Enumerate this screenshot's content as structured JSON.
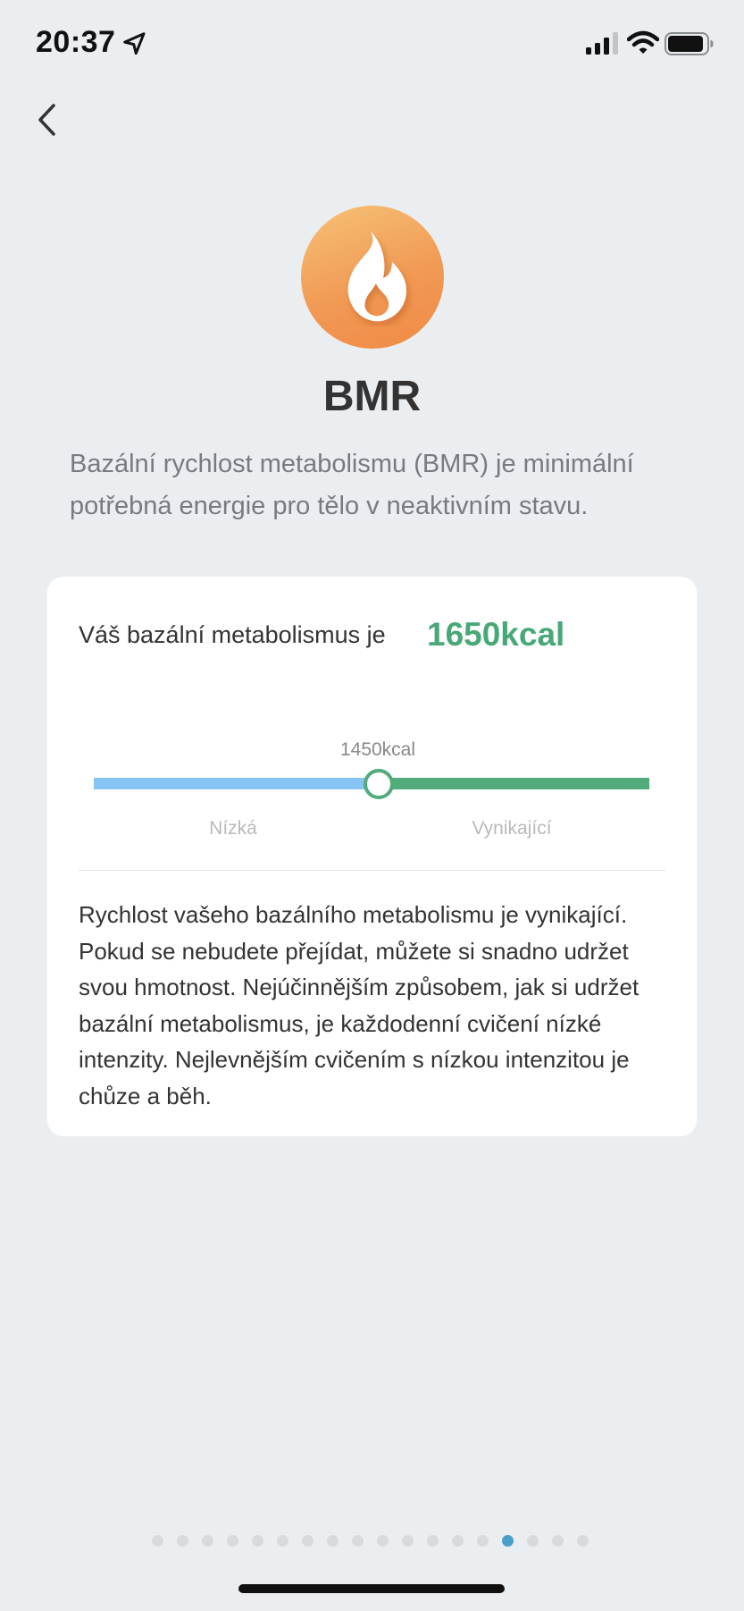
{
  "status_bar": {
    "time": "20:37"
  },
  "header": {
    "back_icon": "chevron-left-icon"
  },
  "hero": {
    "icon": "flame-icon",
    "icon_gradient": [
      "#f6c275",
      "#ef8a45"
    ],
    "title": "BMR",
    "description": "Bazální rychlost metabolismu (BMR) je minimální potřebná energie pro tělo v neaktivním stavu."
  },
  "card": {
    "label": "Váš bazální metabolismus je",
    "value": "1650kcal",
    "value_color": "#48a877",
    "slider": {
      "threshold_label": "1450kcal",
      "low_label": "Nízká",
      "high_label": "Vynikající",
      "low_color": "#86c4f3",
      "high_color": "#52ab7a"
    },
    "body": "Rychlost vašeho bazálního metabolismu je vynikající. Pokud se nebudete přejídat, můžete si snadno udržet svou hmotnost. Nejúčinnějším způsobem, jak si udržet bazální metabolismus, je každodenní cvičení nízké intenzity. Nejlevnějším cvičením s nízkou intenzitou je chůze a běh."
  },
  "pagination": {
    "total": 18,
    "active_index": 14,
    "active_color": "#4a9fc9"
  }
}
